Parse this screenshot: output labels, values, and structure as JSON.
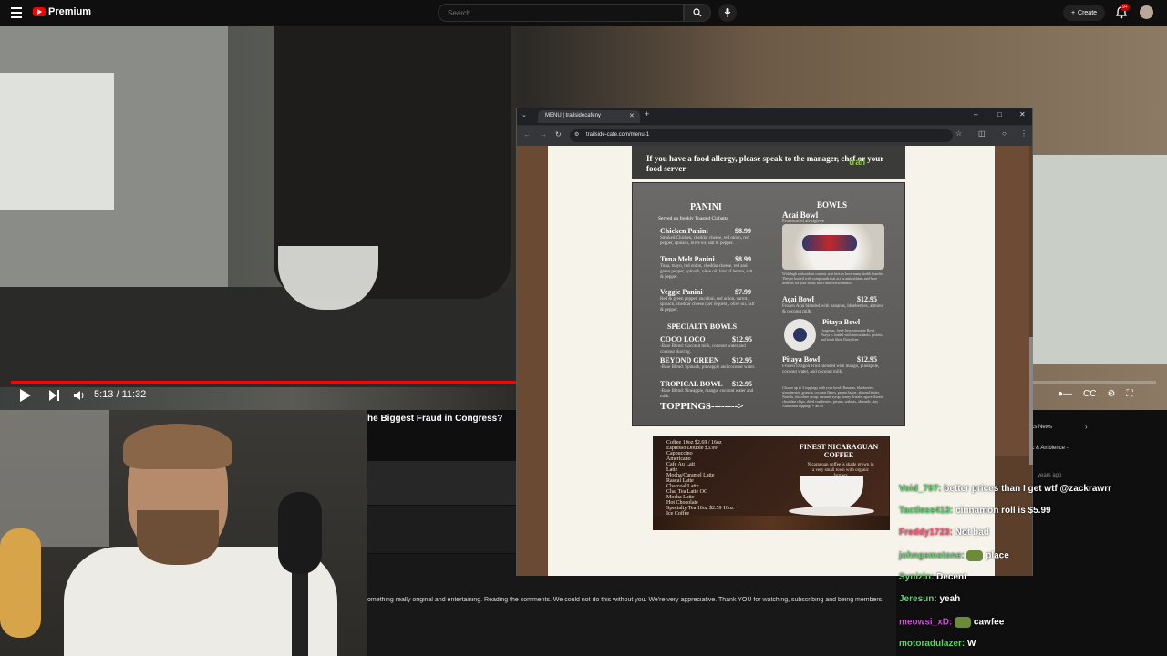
{
  "topbar": {
    "brand": "Premium",
    "search_placeholder": "Search",
    "create_label": "Create",
    "notification_count": "9+"
  },
  "player": {
    "time": "5:13 / 11:32",
    "progress": 0.4538
  },
  "video_info": {
    "title_fragment": "he Biggest Fraud in Congress?",
    "description_fragment": "omething really original and entertaining. Reading the comments. We could not do this without you. We're very appreciative. Thank YOU for watching, subscribing and being members."
  },
  "sidebar_peek": {
    "news": "ics News",
    "ambience": "ic & Ambience -",
    "ago": "years ago"
  },
  "browser": {
    "tab_title": "MENU | trailsidecafeny",
    "url": "trailside-cafe.com/menu-1"
  },
  "menu": {
    "allergy_notice": "If you have a food allergy, please speak to the manager, chef or your food server",
    "panini_header": "PANINI",
    "panini_sub": "Served on freshly Toasted Ciabatta",
    "bowls_header": "BOWLS",
    "paninis": [
      {
        "name": "Chicken Panini",
        "price": "$8.99",
        "desc": "Smoked Chicken, cheddar cheese, red onion, red pepper, spinach, olive oil, salt & pepper."
      },
      {
        "name": "Tuna Melt Panini",
        "price": "$8.99",
        "desc": "Tuna, mayo, red onion, cheddar cheese, red and green pepper, spinach, olive oil, hint of lemon, salt & pepper."
      },
      {
        "name": "Veggie Panini",
        "price": "$7.99",
        "desc": "Red & green pepper, zucchini, red onion, carrot, spinach, cheddar cheese (per request), olive oil, salt & pepper."
      }
    ],
    "specialty_header": "SPECIALTY BOWLS",
    "specialty": [
      {
        "name": "COCO LOCO",
        "price": "$12.95",
        "desc": "-Base Blend: Coconut milk, coconut water and coconut shaving."
      },
      {
        "name": "BEYOND GREEN",
        "price": "$12.95",
        "desc": "-Base Blend: Spinach, pineapple and coconut water."
      },
      {
        "name": "TROPICAL BOWL",
        "price": "$12.95",
        "desc": "-Base Blend: Pineapple, mango, coconut water and milk."
      }
    ],
    "toppings": "TOPPINGS-------->",
    "acai_title": "Acai Bowl",
    "acai_pron": "Pronounced ah-sigh-ee",
    "acai_note": "With high antioxidant content, acai berries have many health benefits. They're loaded with compounds that act as antioxidants and have benefits for your brain, heart and overall health.",
    "acai_item": {
      "name": "Açai Bowl",
      "price": "$12.95",
      "desc": "Frozen Açai blended with bananas, blueberries, almond & coconut milk"
    },
    "pitaya_title": "Pitaya Bowl",
    "pitaya_note": "Gorgeous, fresh fiery smoothie Bowl. Pitaya is loaded with antioxidants, protein, and fresh fiber. Dairy free.",
    "pitaya_item": {
      "name": "Pitaya Bowl",
      "price": "$12.95",
      "desc": "Frozen Dragon Fruit blended with mango, pineapple, coconut water, and coconut milk."
    },
    "toppings_note": "Choose up to 3 toppings with your bowl: Bananas, blueberries, strawberries, granola, coconut flakes, peanut butter, almond butter, Nutella, chocolate syrup, caramel syrup, honey drizzle, agave drizzle, chocolate chips, dried cranberries, pecans, walnuts, almonds. Any Additional toppings + $0.50",
    "coffee_title": "FINEST NICARAGUAN COFFEE",
    "coffee_note": "Nicaraguan coffee is shade grown in a very small town with organic farmers",
    "coffee_items": [
      "Coffee      10oz $2.69 / 16oz",
      "Espresso       Double $3.99",
      "Cappuccino",
      "Americano",
      "Cafe Au Lait",
      "Latte",
      "Mocha/Caramel Latte",
      "Rascal Latte",
      "Charcoal Latte",
      "Chai Tea Latte OG",
      "Mocha Latte",
      "Hot Chocolate",
      "Specialty Tea 10oz $2.59 16oz",
      "Ice Coffee"
    ]
  },
  "chat": [
    {
      "user": "Void_797:",
      "msg": "better prices than I get wtf @zackrawrr",
      "color": "green"
    },
    {
      "user": "Tactless413:",
      "msg": "cinnamon roll is $5.99",
      "color": "green"
    },
    {
      "user": "Freddy1723:",
      "msg": "Not bad",
      "color": "pink"
    },
    {
      "user": "johngemstone:",
      "msg": "place",
      "color": "green",
      "emote": true
    },
    {
      "user": "Synizin:",
      "msg": "Decent",
      "color": "green"
    },
    {
      "user": "Jeresun:",
      "msg": "yeah",
      "color": "green"
    },
    {
      "user": "meowsi_xD:",
      "msg": "cawfee",
      "color": "mag",
      "emote": true
    },
    {
      "user": "motoradulazer:",
      "msg": "W",
      "color": "green"
    }
  ]
}
